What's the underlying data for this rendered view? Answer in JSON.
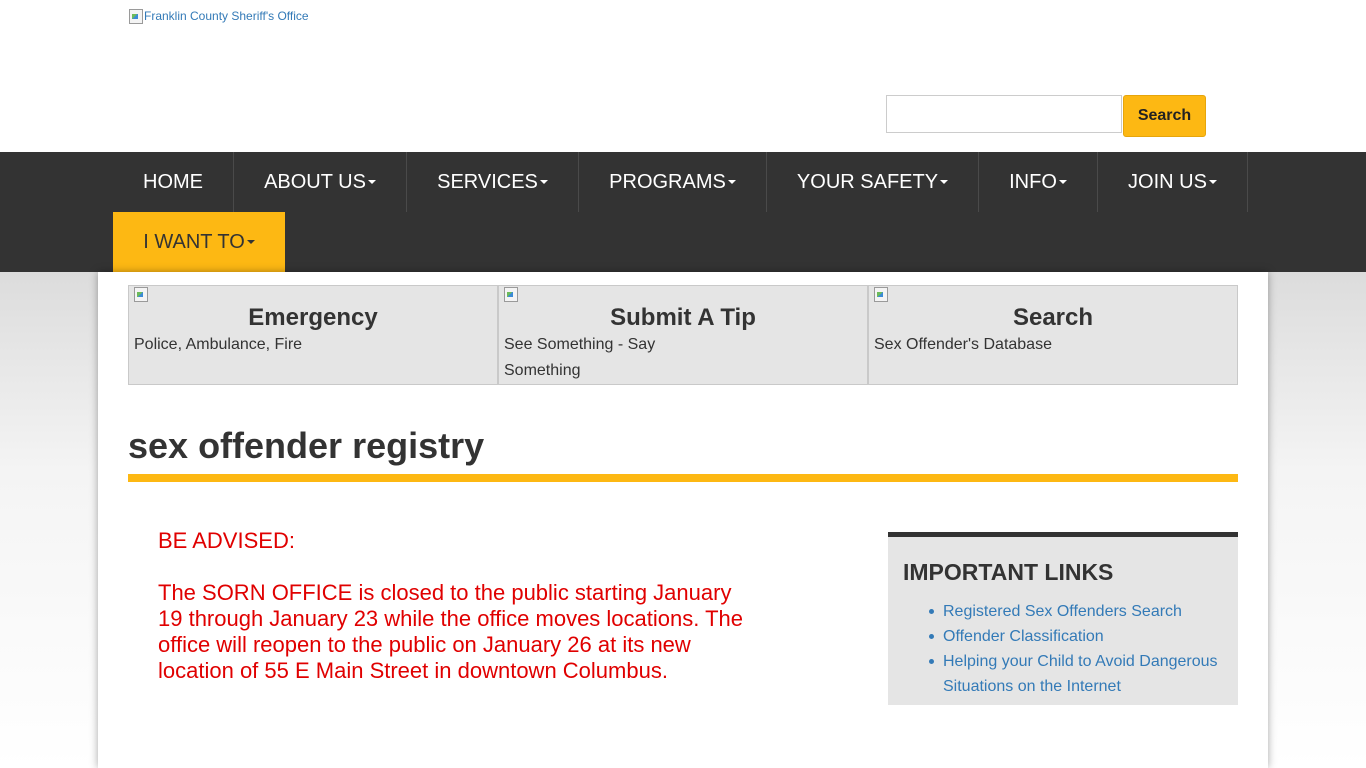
{
  "header": {
    "logo_alt": "Franklin County Sheriff's Office",
    "search_placeholder": "",
    "search_button": "Search"
  },
  "nav": {
    "items": [
      {
        "label": "HOME",
        "dropdown": false
      },
      {
        "label": "ABOUT US",
        "dropdown": true
      },
      {
        "label": "SERVICES",
        "dropdown": true
      },
      {
        "label": "PROGRAMS",
        "dropdown": true
      },
      {
        "label": "YOUR SAFETY",
        "dropdown": true
      },
      {
        "label": "INFO",
        "dropdown": true
      },
      {
        "label": "JOIN US",
        "dropdown": true
      },
      {
        "label": "I WANT TO",
        "dropdown": true,
        "active": true
      }
    ]
  },
  "quick_links": [
    {
      "title": "Emergency",
      "subtitle": "Police, Ambulance, Fire"
    },
    {
      "title": "Submit A Tip",
      "subtitle": "See Something - Say Something"
    },
    {
      "title": "Search",
      "subtitle": "Sex Offender's Database"
    }
  ],
  "page": {
    "title": "sex offender registry"
  },
  "advisory": {
    "heading": "BE ADVISED:",
    "body": "The SORN OFFICE is closed to the public starting January 19 through January 23 while the office moves locations.  The office will reopen to the public on January 26 at its new location of 55 E Main Street in downtown Columbus."
  },
  "sidebar": {
    "title": "IMPORTANT LINKS",
    "links": [
      "Registered Sex Offenders Search",
      "Offender Classification",
      "Helping your Child to Avoid Dangerous Situations on the Internet"
    ]
  },
  "colors": {
    "accent": "#fdb813",
    "nav_bg": "#333333",
    "link": "#337ab7",
    "alert": "#e00000"
  }
}
